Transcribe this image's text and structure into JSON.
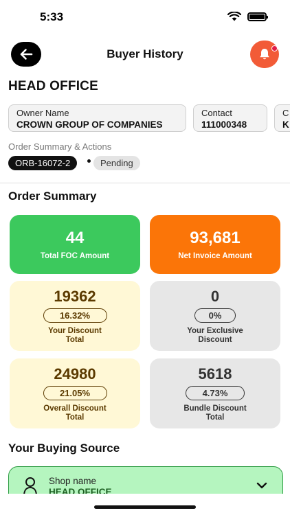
{
  "status_bar": {
    "time": "5:33"
  },
  "header": {
    "title": "Buyer History"
  },
  "office": {
    "title": "HEAD OFFICE"
  },
  "info": {
    "owner_label": "Owner Name",
    "owner_value": "CROWN GROUP OF COMPANIES",
    "contact_label": "Contact",
    "contact_value": "111000348",
    "third_label": "C",
    "third_value": "K"
  },
  "order": {
    "section_label": "Order Summary & Actions",
    "id": "ORB-16072-2",
    "status": "Pending"
  },
  "summary": {
    "title": "Order Summary",
    "total_foc": {
      "value": "44",
      "label": "Total FOC Amount"
    },
    "net_invoice": {
      "value": "93,681",
      "label": "Net Invoice Amount"
    },
    "your_discount": {
      "value": "19362",
      "pct": "16.32%",
      "label_line1": "Your Discount",
      "label_line2": "Total"
    },
    "exclusive_discount": {
      "value": "0",
      "pct": "0%",
      "label_line1": "Your Exclusive",
      "label_line2": "Discount"
    },
    "overall_discount": {
      "value": "24980",
      "pct": "21.05%",
      "label_line1": "Overall Discount",
      "label_line2": "Total"
    },
    "bundle_discount": {
      "value": "5618",
      "pct": "4.73%",
      "label_line1": "Bundle Discount",
      "label_line2": "Total"
    }
  },
  "buying_source": {
    "title": "Your Buying Source",
    "shop_label": "Shop name",
    "shop_value": "HEAD OFFICE"
  },
  "colors": {
    "foc_green": "#3cc95d",
    "net_orange": "#fb7508",
    "discount_cream": "#fff8d6",
    "neutral_gray": "#e7e7e7",
    "bell_red": "#f25b37",
    "source_green": "#b5f5bf"
  },
  "icons": [
    "back-arrow-icon",
    "bell-icon",
    "wifi-icon",
    "battery-icon",
    "person-icon",
    "chevron-down-icon"
  ]
}
